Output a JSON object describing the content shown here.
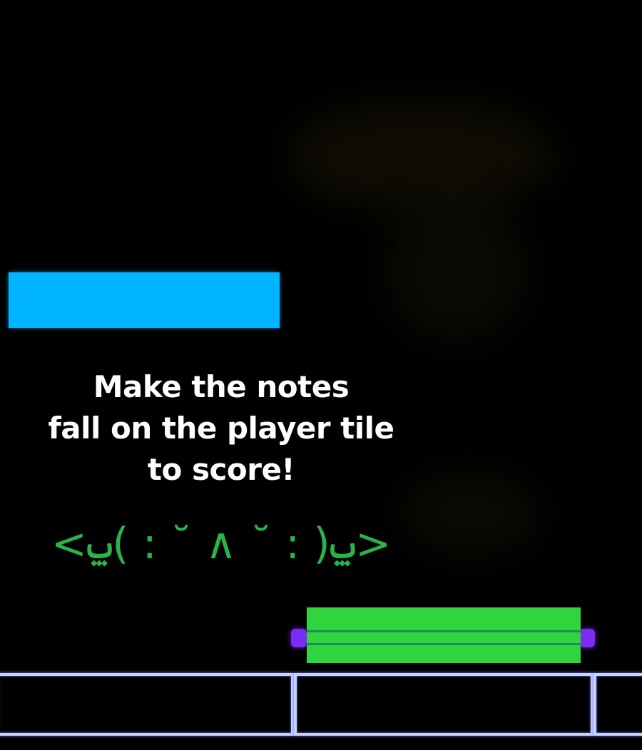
{
  "game": {
    "instruction_lines": [
      "Make the notes",
      "fall on the player tile",
      "to score!"
    ],
    "emoticon": "<ݐ( : ˘ ∧ ˘ : )ݐ>"
  },
  "colors": {
    "background": "#000000",
    "falling_note": "#00b4ff",
    "player_tile": "#2fd43f",
    "player_caps": "#7a2cf0",
    "emoticon": "#2bb34a",
    "lane_border": "#c8d0ff"
  },
  "lanes": {
    "count": 3
  }
}
